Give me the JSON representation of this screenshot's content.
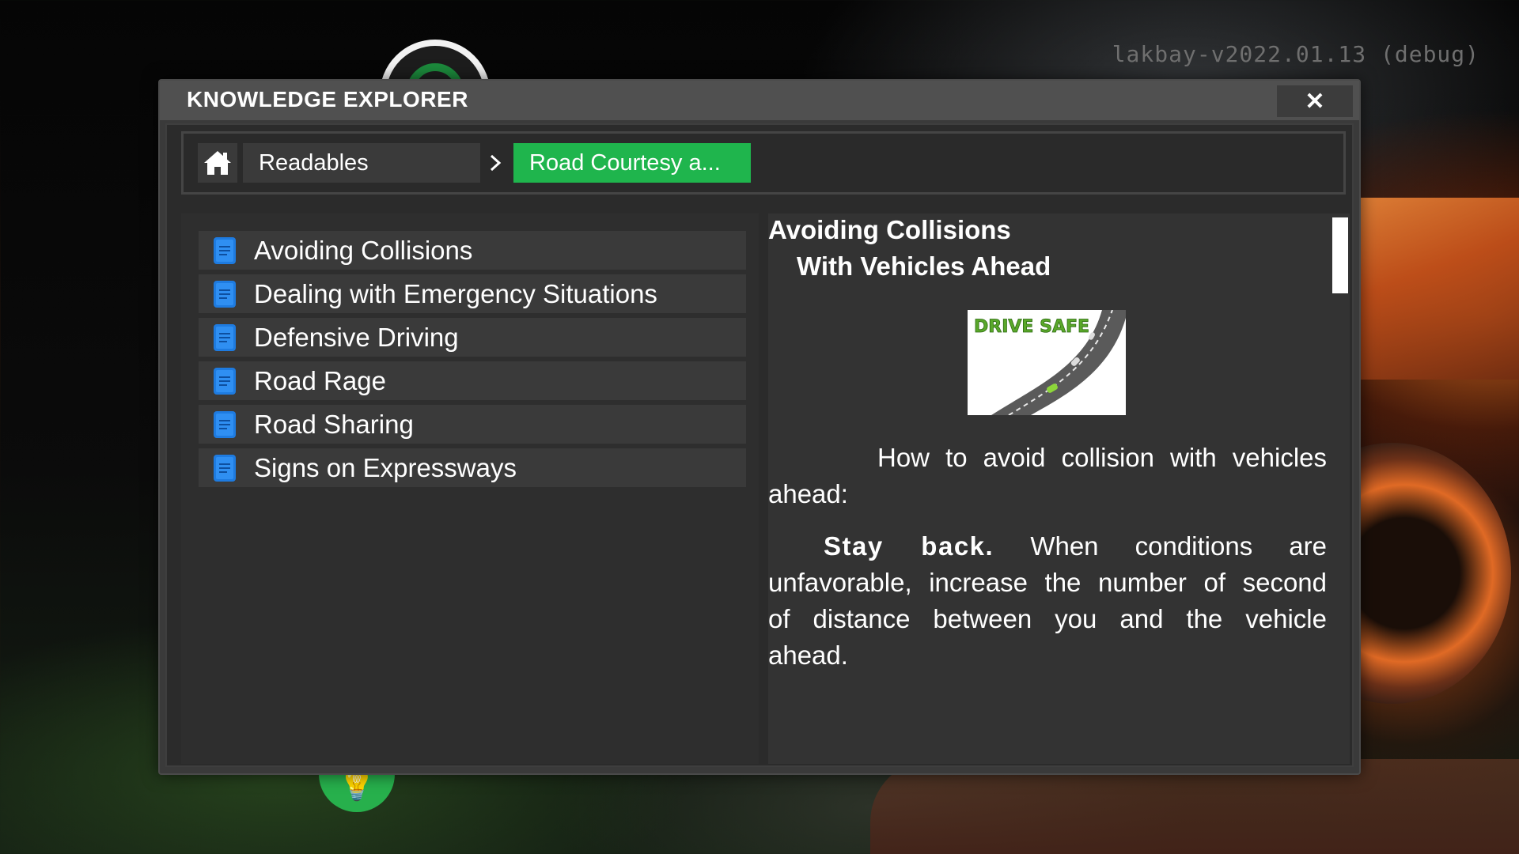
{
  "version_label": "lakbay-v2022.01.13 (debug)",
  "window": {
    "title": "KNOWLEDGE EXPLORER",
    "close_label": "✕"
  },
  "breadcrumb": {
    "home_icon": "home-icon",
    "readables": "Readables",
    "separator": ">",
    "current": "Road Courtesy a..."
  },
  "list": {
    "items": [
      {
        "label": "Avoiding Collisions",
        "icon": "document-icon"
      },
      {
        "label": "Dealing with Emergency Situations",
        "icon": "document-icon"
      },
      {
        "label": "Defensive Driving",
        "icon": "document-icon"
      },
      {
        "label": "Road Rage",
        "icon": "document-icon"
      },
      {
        "label": "Road Sharing",
        "icon": "document-icon"
      },
      {
        "label": "Signs on Expressways",
        "icon": "document-icon"
      }
    ]
  },
  "reader": {
    "title_line1": "Avoiding Collisions",
    "title_line2": "With Vehicles Ahead",
    "image_text": "DRIVE SAFE",
    "intro": "How to avoid collision with vehicles ahead:",
    "para_bold": "Stay back.",
    "para_rest": "When conditions are unfavorable, increase the number of second of distance between you and the vehicle ahead."
  },
  "colors": {
    "accent_green": "#1fb54d",
    "doc_icon_blue": "#1e7be0",
    "window_bg": "#3a3a3a"
  }
}
